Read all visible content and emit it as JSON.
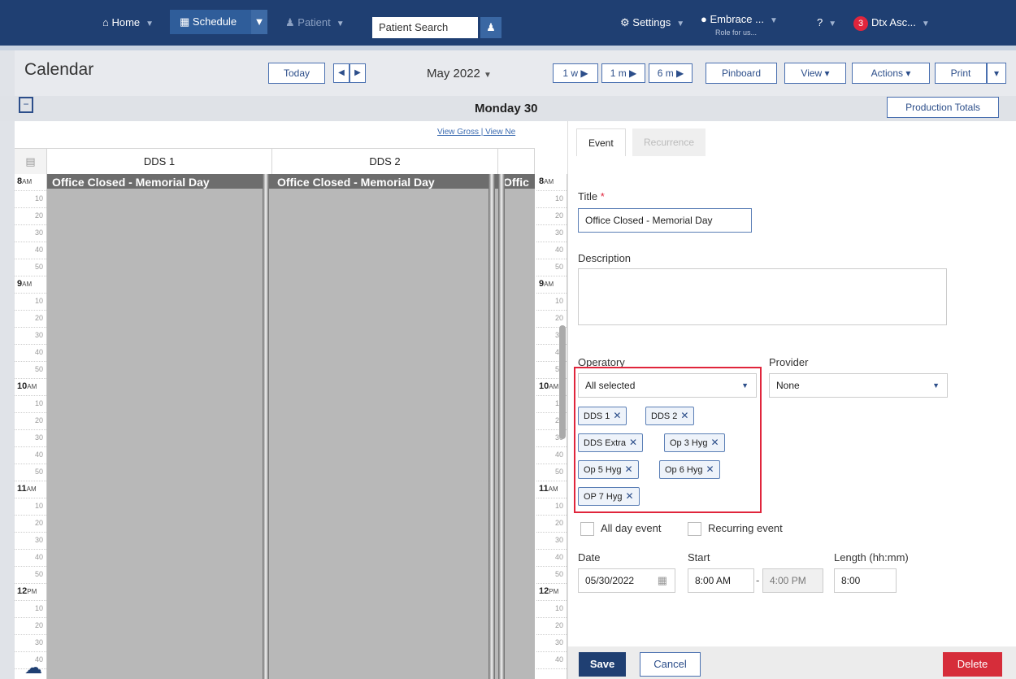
{
  "nav": {
    "home": "Home",
    "schedule": "Schedule",
    "patient": "Patient",
    "search_placeholder": "Patient Search",
    "settings": "Settings",
    "location": "Embrace ...",
    "location_sub": "Role for us...",
    "help": "?",
    "notif_count": "3",
    "user": "Dtx Asc..."
  },
  "header": {
    "title": "Calendar",
    "today": "Today",
    "month": "May 2022",
    "range_1w": "1 w",
    "range_1m": "1 m",
    "range_6m": "6 m",
    "pinboard": "Pinboard",
    "view": "View",
    "actions": "Actions",
    "print": "Print"
  },
  "dayrow": {
    "title": "Monday 30",
    "production_totals": "Production Totals"
  },
  "calendar": {
    "links": "View Gross   |   View Ne",
    "columns": [
      "DDS 1",
      "DDS 2"
    ],
    "event_title": "Office Closed - Memorial Day",
    "event_title_clipped": "Offic",
    "hours": [
      "8",
      "9",
      "10",
      "11",
      "12"
    ],
    "hour_suffix": [
      "AM",
      "AM",
      "AM",
      "AM",
      "PM"
    ],
    "minutes": [
      "10",
      "20",
      "30",
      "40",
      "50"
    ]
  },
  "panel": {
    "tabs": [
      "Event",
      "Recurrence"
    ],
    "title_label": "Title",
    "title_required": "*",
    "title_value": "Office Closed - Memorial Day",
    "description_label": "Description",
    "operatory_label": "Operatory",
    "operatory_value": "All selected",
    "provider_label": "Provider",
    "provider_value": "None",
    "operatory_chips": [
      "DDS 1",
      "DDS 2",
      "DDS Extra",
      "Op 3 Hyg",
      "Op 5 Hyg",
      "Op 6 Hyg",
      "OP 7 Hyg"
    ],
    "all_day_label": "All day event",
    "recurring_label": "Recurring event",
    "date_label": "Date",
    "date_value": "05/30/2022",
    "start_label": "Start",
    "start_value": "8:00 AM",
    "end_value": "4:00 PM",
    "length_label": "Length (hh:mm)",
    "length_value": "8:00",
    "save": "Save",
    "cancel": "Cancel",
    "delete": "Delete"
  },
  "colors": {
    "nav_bg": "#1f3f72",
    "accent": "#2c4e8a",
    "highlight_box": "#e0253c",
    "event_bg": "#b8b8b8"
  }
}
